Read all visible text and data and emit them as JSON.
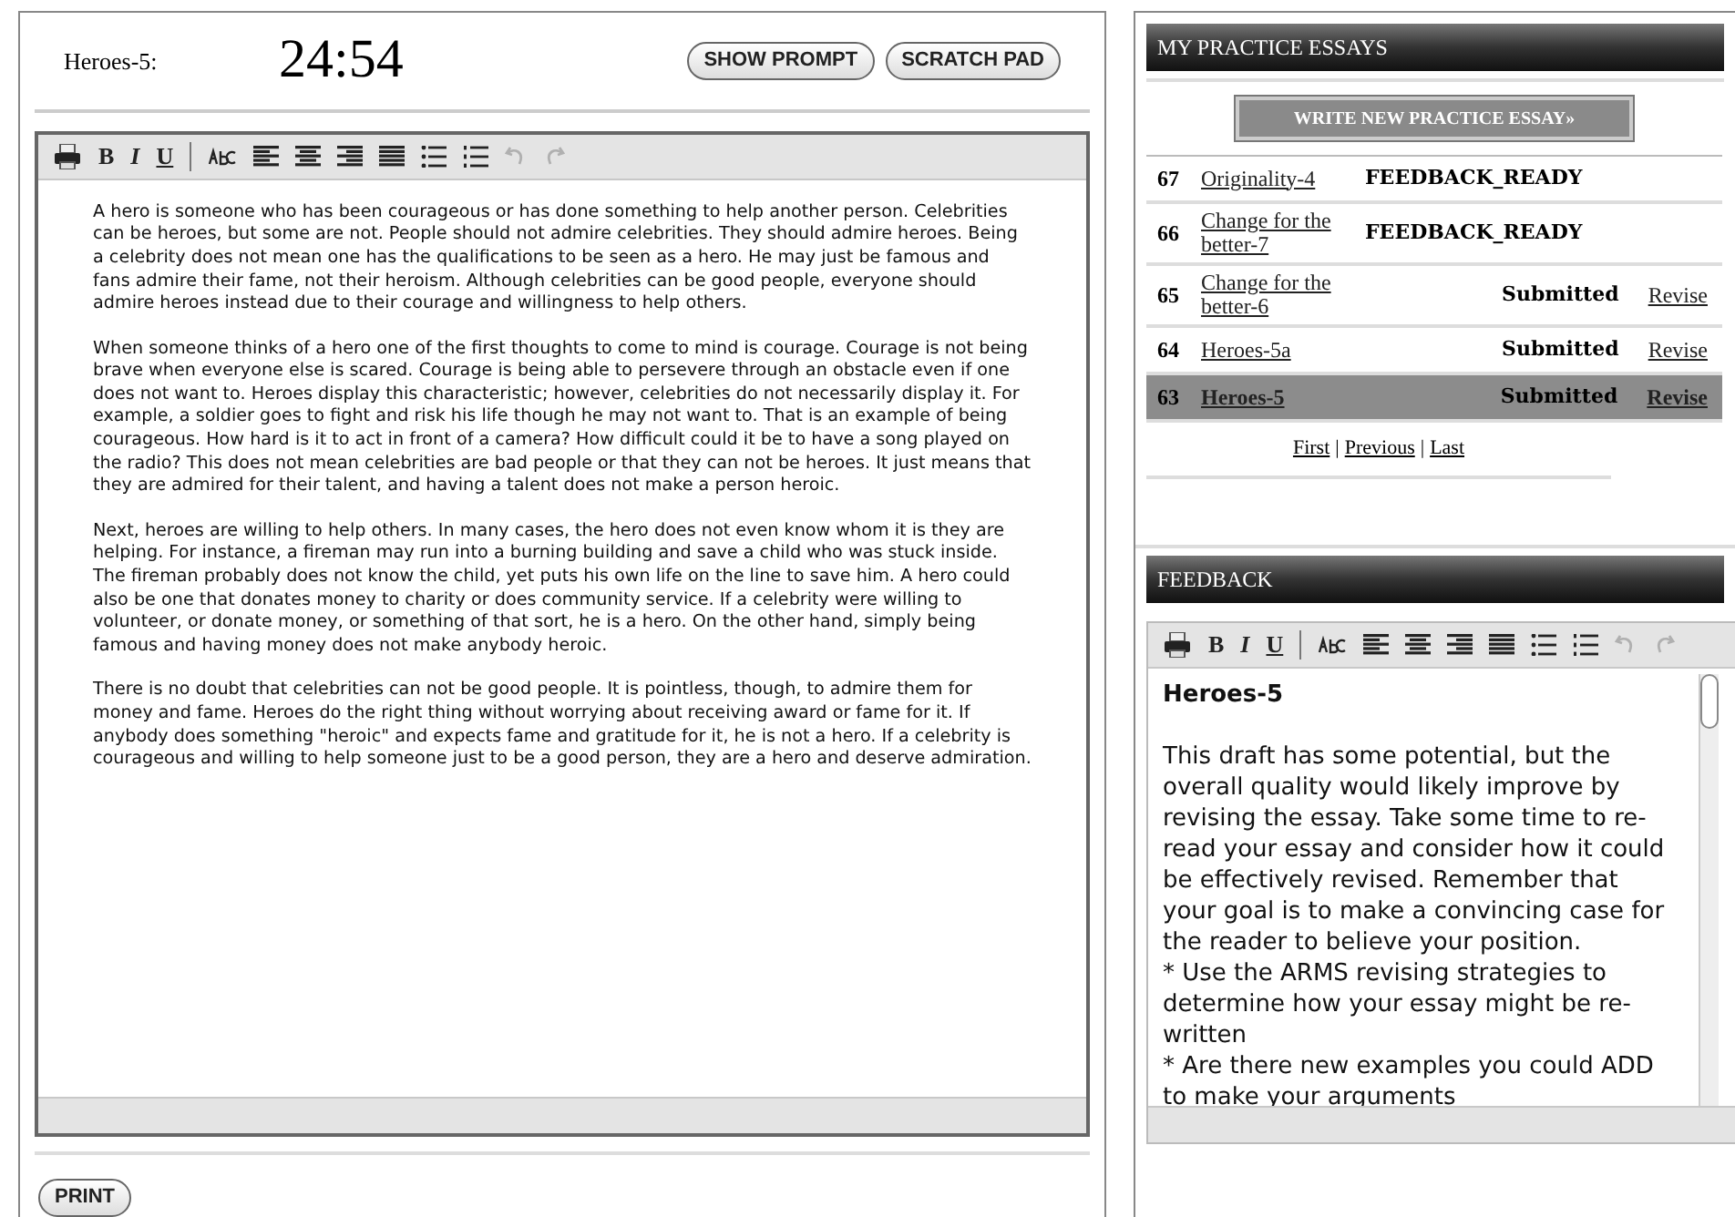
{
  "essay_panel": {
    "title": "Heroes-5:",
    "timer": "24:54",
    "buttons": [
      "SHOW PROMPT",
      "SCRATCH PAD"
    ],
    "toolbar": [
      {
        "kind": "print",
        "disabled": false
      },
      {
        "kind": "bold",
        "label": "B",
        "disabled": false
      },
      {
        "kind": "italic",
        "label": "I",
        "disabled": false
      },
      {
        "kind": "underline",
        "label": "U",
        "disabled": false
      },
      {
        "kind": "separator",
        "disabled": false
      },
      {
        "kind": "spellcheck",
        "disabled": false
      },
      {
        "kind": "align_left",
        "disabled": false
      },
      {
        "kind": "align_center",
        "disabled": false
      },
      {
        "kind": "align_right",
        "disabled": false
      },
      {
        "kind": "justify",
        "disabled": false
      },
      {
        "kind": "bullets",
        "disabled": false
      },
      {
        "kind": "numbers",
        "disabled": false
      },
      {
        "kind": "undo",
        "disabled": true
      },
      {
        "kind": "redo",
        "disabled": true
      }
    ],
    "paragraphs": [
      "A hero is someone who has been courageous or has done something to help another person. Celebrities can be heroes, but some are not. People should not admire celebrities. They should admire heroes. Being a celebrity does not mean one has the qualifications to be seen as a hero. He may just be famous and fans admire their fame, not their heroism. Although celebrities can be good people, everyone should admire heroes instead due to their courage and willingness to help others.",
      "When someone thinks of a hero one of the first thoughts to come to mind is courage. Courage is not being brave when everyone else is scared. Courage is being able to persevere through an obstacle even if one does not want to. Heroes display this characteristic; however, celebrities do not necessarily display it. For example, a soldier goes to fight and risk his life though he may not want to. That is an example of being courageous. How hard is it to act in front of a camera? How difficult could it be to have a song played on the radio? This does not mean celebrities are bad people or that they can not be heroes. It just means that they are admired for their talent, and having a talent does not make a person heroic.",
      "Next, heroes are willing to help others. In many cases, the hero does not even know whom it is they are helping. For instance, a fireman may run into a burning building and save a child who was stuck inside. The fireman probably does not know the child, yet puts his own life on the line to save him. A hero could also be one that donates money to charity or does community service. If a celebrity were willing to volunteer, or donate money, or something of that sort, he is a hero. On the other hand, simply being famous and having money does not make anybody heroic.",
      "There is no doubt that celebrities can not be good people. It is pointless, though, to admire them for money and fame. Heroes do the right thing without worrying about receiving award or fame for it. If anybody does something \"heroic\" and expects fame and gratitude for it, he is not a hero. If a celebrity is courageous and willing to help someone just to be a good person, they are a hero and deserve admiration."
    ],
    "print_button": "PRINT"
  },
  "practice_essays": {
    "title": "MY PRACTICE ESSAYS",
    "write_button": "WRITE NEW PRACTICE ESSAY»",
    "rows": [
      {
        "number": "67",
        "title": "Originality-4",
        "status": "FEEDBACK_READY",
        "selected": false
      },
      {
        "number": "66",
        "title": "Change for the better-7",
        "status": "FEEDBACK_READY",
        "selected": false
      },
      {
        "number": "65",
        "title": "Change for the better-6",
        "status": "Submitted",
        "revise": "Revise",
        "selected": false
      },
      {
        "number": "64",
        "title": "Heroes-5a",
        "status": "Submitted",
        "revise": "Revise",
        "selected": false
      },
      {
        "number": "63",
        "title": "Heroes-5",
        "status": "Submitted",
        "revise": "Revise",
        "selected": true
      }
    ],
    "pager": [
      {
        "label": "First"
      },
      {
        "label": "Previous"
      },
      {
        "label": "Last"
      }
    ],
    "pager_separator": "|"
  },
  "feedback": {
    "title": "FEEDBACK",
    "toolbar": [
      {
        "kind": "print",
        "disabled": false
      },
      {
        "kind": "bold",
        "label": "B",
        "disabled": false
      },
      {
        "kind": "italic",
        "label": "I",
        "disabled": false
      },
      {
        "kind": "underline",
        "label": "U",
        "disabled": false
      },
      {
        "kind": "separator",
        "disabled": false
      },
      {
        "kind": "spellcheck",
        "disabled": false
      },
      {
        "kind": "align_left",
        "disabled": false
      },
      {
        "kind": "align_center",
        "disabled": false
      },
      {
        "kind": "align_right",
        "disabled": false
      },
      {
        "kind": "justify",
        "disabled": false
      },
      {
        "kind": "bullets",
        "disabled": false
      },
      {
        "kind": "numbers",
        "disabled": false
      },
      {
        "kind": "undo",
        "disabled": true
      },
      {
        "kind": "redo",
        "disabled": true
      }
    ],
    "heading": "Heroes-5",
    "lines": [
      "This draft has some potential, but the overall quality would likely improve by revising the essay. Take some time to re-read your essay and consider how it could be effectively revised. Remember that your goal is to make a convincing case for the reader to believe your position.",
      "* Use the ARMS revising strategies to determine how your essay might be re-written",
      "* Are there new examples you could ADD to make your arguments"
    ]
  }
}
